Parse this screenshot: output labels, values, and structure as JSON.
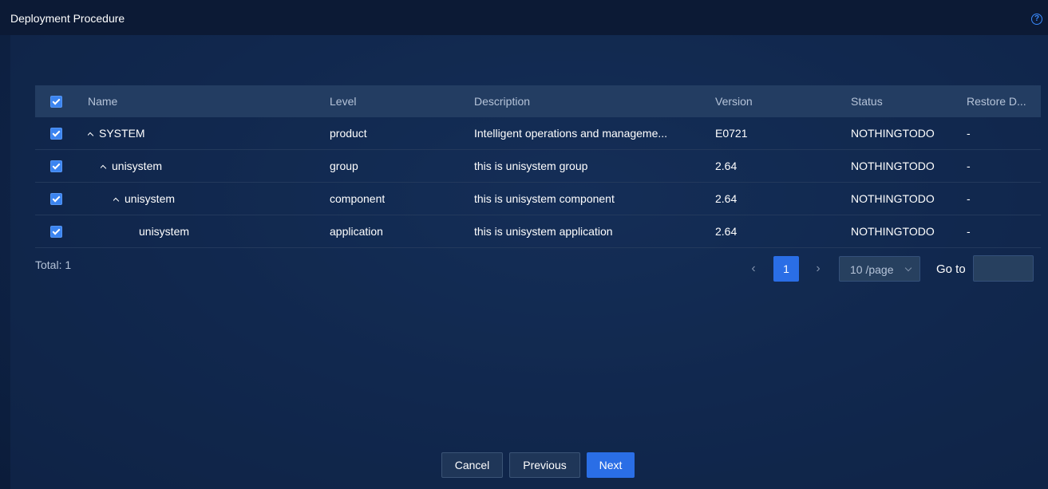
{
  "window": {
    "title": "Deployment Procedure",
    "help_icon": "question-circle-icon",
    "help_glyph": "?"
  },
  "table": {
    "columns": [
      "Name",
      "Level",
      "Description",
      "Version",
      "Status",
      "Restore D..."
    ],
    "rows": [
      {
        "name": "SYSTEM",
        "expanded": true,
        "level": "product",
        "description": "Intelligent operations and manageme...",
        "version": "E0721",
        "status": "NOTHINGTODO",
        "restore": "-"
      },
      {
        "name": "unisystem",
        "expanded": true,
        "level": "group",
        "description": "this is unisystem group",
        "version": "2.64",
        "status": "NOTHINGTODO",
        "restore": "-"
      },
      {
        "name": "unisystem",
        "expanded": true,
        "level": "component",
        "description": "this is unisystem component",
        "version": "2.64",
        "status": "NOTHINGTODO",
        "restore": "-"
      },
      {
        "name": "unisystem",
        "expanded": false,
        "level": "application",
        "description": "this is unisystem application",
        "version": "2.64",
        "status": "NOTHINGTODO",
        "restore": "-"
      }
    ]
  },
  "pagination": {
    "total": "Total: 1",
    "prev_glyph": "‹",
    "next_glyph": "›",
    "current_page": "1",
    "page_size": "10 /page",
    "goto_label": "Go to",
    "goto_value": ""
  },
  "footer": {
    "cancel": "Cancel",
    "previous": "Previous",
    "next": "Next"
  },
  "colors": {
    "accent": "#2a6ee6",
    "background": "#0f2448"
  }
}
